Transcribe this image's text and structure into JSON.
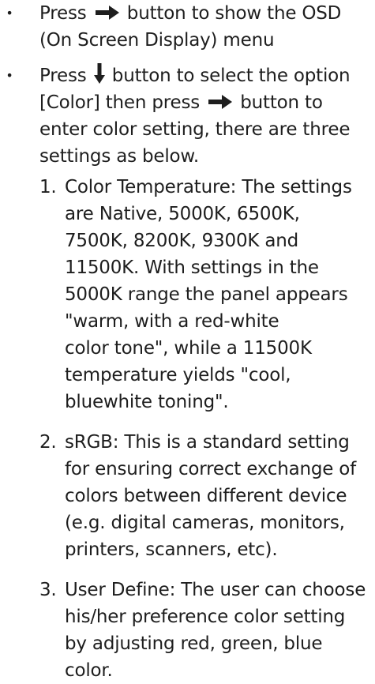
{
  "bullet_symbol": "•",
  "icons": {
    "right": "right-arrow-icon",
    "down": "down-arrow-icon"
  },
  "bullets": [
    {
      "line1_a": "Press",
      "line1_b": "button to show the OSD",
      "line2": "(On Screen Display) menu"
    },
    {
      "line1_a": "Press",
      "line1_b": "button to select the option",
      "line2_a": "[Color] then press",
      "line2_b": "button to",
      "line3": "enter color setting, there are three",
      "line4": "settings as below."
    }
  ],
  "settings": [
    {
      "number": "1.",
      "lines": [
        "Color Temperature: The settings",
        "are Native, 5000K, 6500K,",
        "7500K, 8200K, 9300K and",
        "11500K. With settings in the",
        "5000K range the panel appears",
        "\"warm, with a red-white",
        "color tone\", while a 11500K",
        "temperature yields \"cool,",
        "bluewhite toning\"."
      ]
    },
    {
      "number": "2.",
      "lines": [
        "sRGB: This is a standard setting",
        "for ensuring correct exchange of",
        "colors between different device",
        "(e.g. digital cameras, monitors,",
        "printers, scanners, etc)."
      ]
    },
    {
      "number": "3.",
      "lines": [
        "User Define: The user can choose",
        "his/her preference color setting",
        "by adjusting red, green, blue",
        "color."
      ]
    }
  ]
}
